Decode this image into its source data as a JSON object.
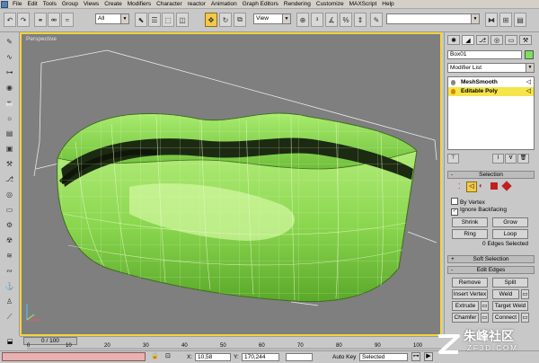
{
  "menu": [
    "File",
    "Edit",
    "Tools",
    "Group",
    "Views",
    "Create",
    "Modifiers",
    "Character",
    "reactor",
    "Animation",
    "Graph Editors",
    "Rendering",
    "Customize",
    "MAXScript",
    "Help"
  ],
  "toolbar": {
    "selection_filter": "All",
    "reference_coord": "View",
    "named_selection": ""
  },
  "viewport": {
    "label": "Perspective",
    "model_color": "#86d64a",
    "background": "#7f7f7f",
    "active_border": "#f2d53c"
  },
  "command_panel": {
    "object_name": "Box01",
    "object_color": "#7be05b",
    "modifier_list": "Modifier List",
    "stack": [
      {
        "label": "MeshSmooth",
        "selected": false
      },
      {
        "label": "Editable Poly",
        "selected": true
      }
    ],
    "selection_rollout": {
      "title": "Selection",
      "sign": "-",
      "by_vertex": "By Vertex",
      "by_vertex_checked": false,
      "ignore_backfacing": "Ignore Backfacing",
      "ignore_backfacing_checked": true,
      "shrink": "Shrink",
      "grow": "Grow",
      "ring": "Ring",
      "loop": "Loop",
      "status": "0 Edges Selected"
    },
    "soft_selection": {
      "title": "Soft Selection",
      "sign": "+"
    },
    "edit_edges": {
      "title": "Edit Edges",
      "sign": "-",
      "buttons": [
        "Remove",
        "Split",
        "Insert Vertex",
        "Weld",
        "Extrude",
        "Target Weld",
        "Chamfer",
        "Connect"
      ]
    }
  },
  "time": {
    "slider": "0 / 100",
    "ticks": [
      "0",
      "10",
      "20",
      "30",
      "40",
      "50",
      "60",
      "70",
      "80",
      "90",
      "100"
    ]
  },
  "status": {
    "x_label": "X:",
    "x_value": "10,58",
    "y_label": "Y:",
    "y_value": "170,244",
    "auto_key": "Auto Key",
    "key_mode": "Selected"
  },
  "watermark": {
    "text": "朱峰社区",
    "sub": "ZF3D.COM"
  }
}
